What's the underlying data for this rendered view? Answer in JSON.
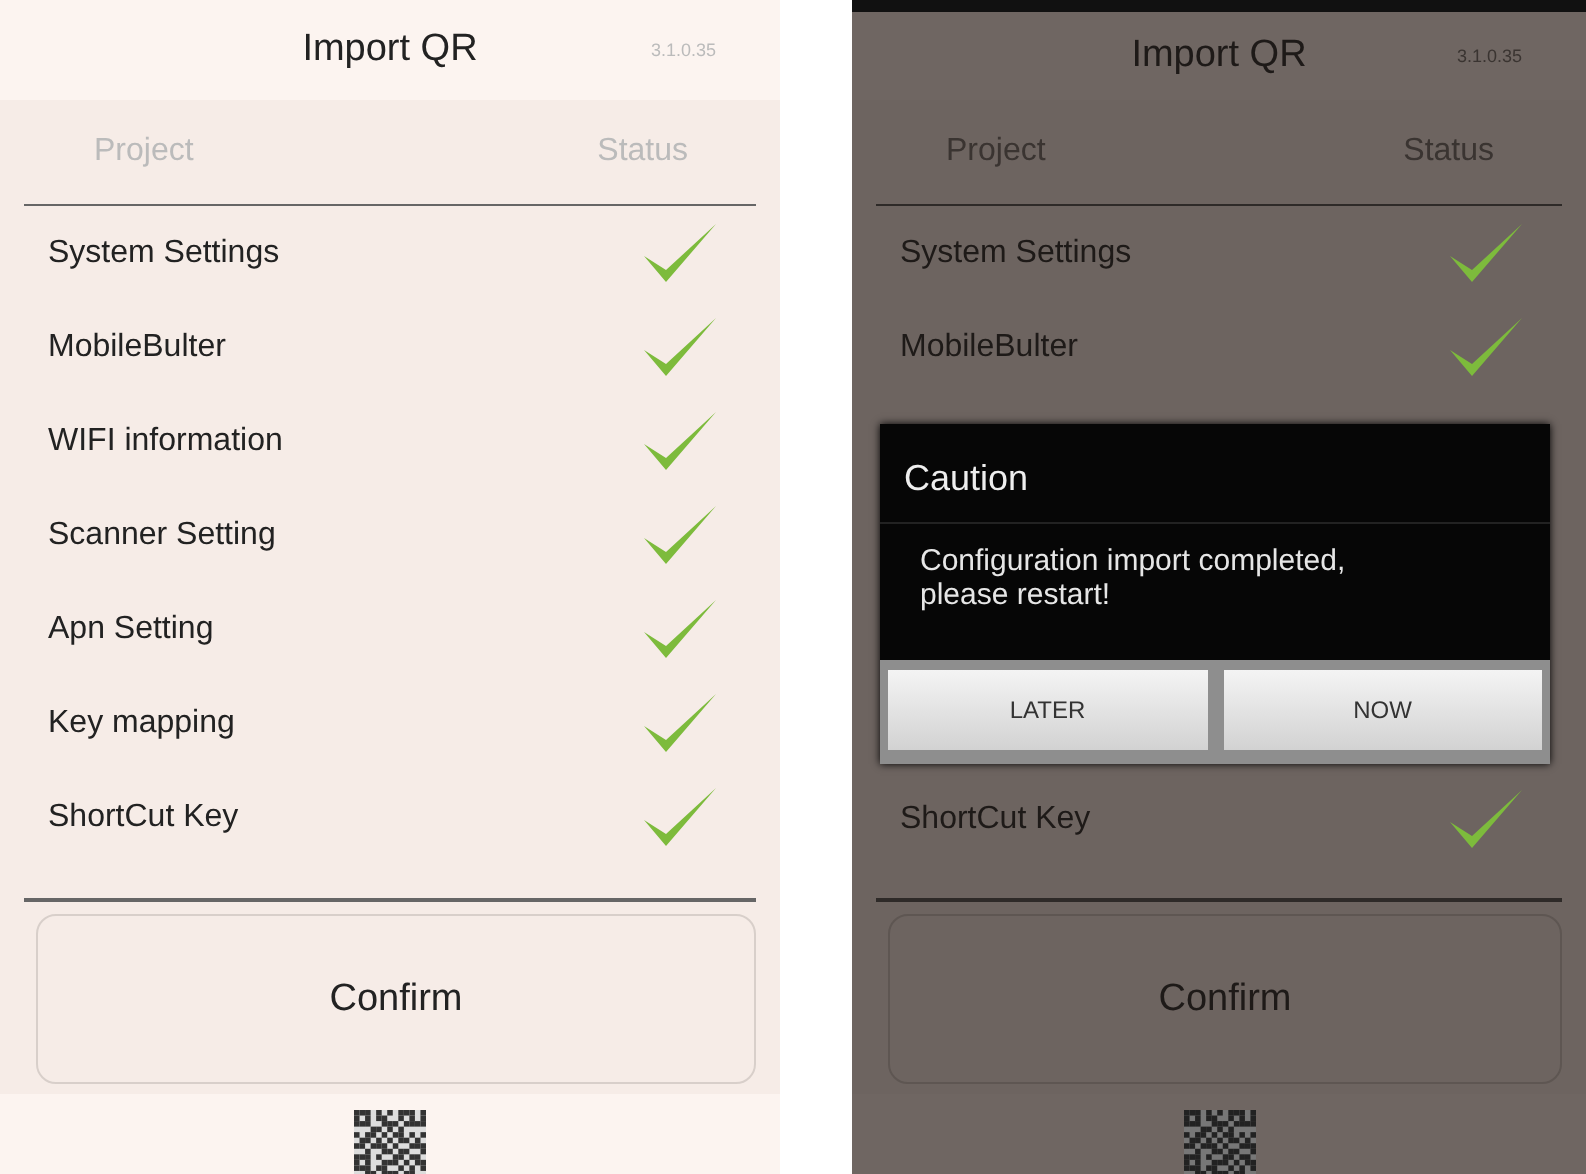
{
  "screens": [
    {
      "dimmed": false,
      "title": "Import QR",
      "version": "3.1.0.35",
      "columns": [
        "Project",
        "Status"
      ],
      "rows": [
        {
          "kind": "row",
          "name": "System Settings",
          "checked": true
        },
        {
          "kind": "row",
          "name": "MobileBulter",
          "checked": true
        },
        {
          "kind": "row",
          "name": "WIFI information",
          "checked": true
        },
        {
          "kind": "row",
          "name": "Scanner Setting",
          "checked": true
        },
        {
          "kind": "row",
          "name": "Apn Setting",
          "checked": true
        },
        {
          "kind": "row",
          "name": "Key mapping",
          "checked": true
        },
        {
          "kind": "row",
          "name": "ShortCut Key",
          "checked": true
        }
      ],
      "confirm": "Confirm"
    },
    {
      "dimmed": true,
      "title": "Import QR",
      "version": "3.1.0.35",
      "columns": [
        "Project",
        "Status"
      ],
      "rows": [
        {
          "kind": "row",
          "name": "System Settings",
          "checked": true
        },
        {
          "kind": "row",
          "name": "MobileBulter",
          "checked": true
        },
        {
          "kind": "dialog",
          "title": "Caution",
          "message": "Configuration import completed, please restart!",
          "buttons": [
            "LATER",
            "NOW"
          ]
        },
        {
          "kind": "row",
          "name": "ShortCut Key",
          "checked": true
        }
      ],
      "confirm": "Confirm"
    }
  ]
}
